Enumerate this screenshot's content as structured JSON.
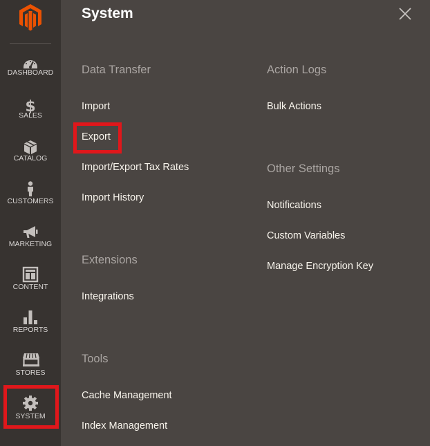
{
  "sidebar": {
    "logo": "magento-logo",
    "items": [
      {
        "label": "DASHBOARD",
        "icon": "dashboard-icon"
      },
      {
        "label": "SALES",
        "icon": "dollar-icon"
      },
      {
        "label": "CATALOG",
        "icon": "box-icon"
      },
      {
        "label": "CUSTOMERS",
        "icon": "person-icon"
      },
      {
        "label": "MARKETING",
        "icon": "megaphone-icon"
      },
      {
        "label": "CONTENT",
        "icon": "layout-icon"
      },
      {
        "label": "REPORTS",
        "icon": "bar-chart-icon"
      },
      {
        "label": "STORES",
        "icon": "storefront-icon"
      },
      {
        "label": "SYSTEM",
        "icon": "gear-icon"
      }
    ]
  },
  "panel": {
    "title": "System",
    "close_icon": "close-icon",
    "sections": {
      "data_transfer": {
        "title": "Data Transfer",
        "links": [
          "Import",
          "Export",
          "Import/Export Tax Rates",
          "Import History"
        ]
      },
      "extensions": {
        "title": "Extensions",
        "links": [
          "Integrations"
        ]
      },
      "tools": {
        "title": "Tools",
        "links": [
          "Cache Management",
          "Index Management"
        ]
      },
      "action_logs": {
        "title": "Action Logs",
        "links": [
          "Bulk Actions"
        ]
      },
      "other_settings": {
        "title": "Other Settings",
        "links": [
          "Notifications",
          "Custom Variables",
          "Manage Encryption Key"
        ]
      }
    }
  },
  "colors": {
    "sidebar_bg": "#373330",
    "panel_bg": "#4a4542",
    "brand_orange": "#eb5202",
    "highlight_red": "#e0171b",
    "section_title": "#aaa5a2",
    "link_text": "#f7f3eb"
  }
}
